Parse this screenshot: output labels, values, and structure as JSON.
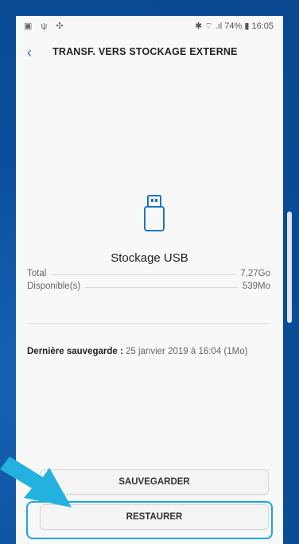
{
  "status": {
    "left_icons": "▣ ψ ✣",
    "right_text": "✱ ⌔ .ıl 74% ▮ 16:05"
  },
  "header": {
    "back_icon": "‹",
    "title": "TRANSF. VERS STOCKAGE EXTERNE"
  },
  "device": {
    "icon": "usb-drive-icon",
    "name": "Stockage USB"
  },
  "storage": {
    "total_label": "Total",
    "total_value": "7,27Go",
    "available_label": "Disponible(s)",
    "available_value": "539Mo"
  },
  "backup": {
    "label": "Dernière sauvegarde :",
    "value": "25 janvier 2019 à 16:04 (1Mo)"
  },
  "buttons": {
    "save": "SAUVEGARDER",
    "restore": "RESTAURER"
  },
  "colors": {
    "accent": "#1c74c4",
    "highlight": "#1aa6da",
    "arrow": "#23b2e0",
    "background": "#0b4f9c"
  }
}
